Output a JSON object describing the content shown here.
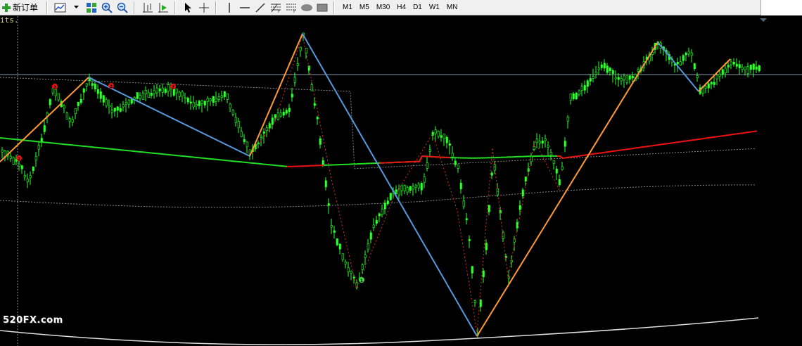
{
  "toolbar": {
    "new_order_label": "新订单",
    "timeframes": [
      "M1",
      "M5",
      "M30",
      "H4",
      "D1",
      "W1",
      "MN"
    ]
  },
  "chart": {
    "corner_text": "its.",
    "watermark": "520FX.com",
    "colors": {
      "background": "#000000",
      "candle": "#33ff33",
      "ma_green": "#22dd22",
      "ma_red": "#ee1111",
      "zigzag_up": "#ff9933",
      "zigzag_down": "#5599dd",
      "price_line": "#8899aa",
      "band": "#888888",
      "marker_red": "#ee1111",
      "marker_green": "#44dd44"
    },
    "markers": [
      {
        "label": "2",
        "color": "red"
      },
      {
        "label": "2",
        "color": "red"
      },
      {
        "label": "2",
        "color": "red"
      },
      {
        "label": "2",
        "color": "red"
      },
      {
        "label": "1",
        "color": "green"
      }
    ]
  }
}
